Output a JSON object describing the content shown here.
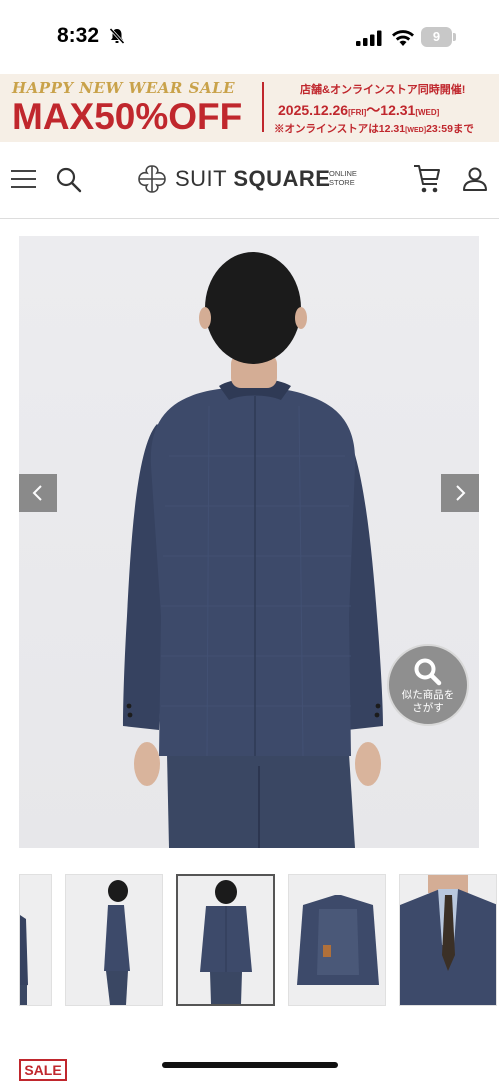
{
  "status_bar": {
    "time": "8:32",
    "battery": "9"
  },
  "banner": {
    "line1": "HAPPY NEW WEAR SALE",
    "line2": "MAX50%OFF",
    "right1": "店舗&オンラインストア同時開催!",
    "right2_date1": "2025.12.26",
    "right2_day1": "[FRI]",
    "right2_sep": "〜",
    "right2_date2": "12.31",
    "right2_day2": "[WED]",
    "right3_prefix": "※オンラインストアは12.31",
    "right3_day": "[WED]",
    "right3_time": "23:59まで"
  },
  "header": {
    "logo_light": "SUIT ",
    "logo_bold": "SQUARE",
    "logo_sub1": "ONLINE",
    "logo_sub2": "STORE"
  },
  "product": {
    "similar_line1": "似た商品を",
    "similar_line2": "さがす",
    "badge": "SALE"
  },
  "colors": {
    "accent": "#c0272d",
    "gold": "#c9a24a",
    "suit": "#3b4a66"
  }
}
